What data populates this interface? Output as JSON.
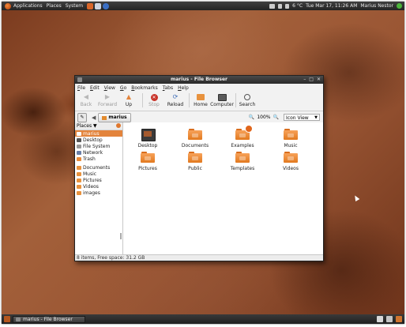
{
  "top_panel": {
    "menus": [
      "Applications",
      "Places",
      "System"
    ],
    "weather": "6 °C",
    "clock": "Tue Mar 17, 11:26 AM",
    "user": "Marius Nestor"
  },
  "window": {
    "title": "marius - File Browser",
    "menu": [
      "File",
      "Edit",
      "View",
      "Go",
      "Bookmarks",
      "Tabs",
      "Help"
    ],
    "toolbar": [
      {
        "label": "Back",
        "icon": "back-arrow-icon",
        "enabled": false
      },
      {
        "label": "Forward",
        "icon": "forward-arrow-icon",
        "enabled": false
      },
      {
        "label": "Up",
        "icon": "up-arrow-icon",
        "enabled": true
      },
      {
        "label": "Stop",
        "icon": "stop-icon",
        "enabled": false
      },
      {
        "label": "Reload",
        "icon": "reload-icon",
        "enabled": true
      },
      {
        "label": "Home",
        "icon": "home-icon",
        "enabled": true
      },
      {
        "label": "Computer",
        "icon": "computer-icon",
        "enabled": true
      },
      {
        "label": "Search",
        "icon": "search-icon",
        "enabled": true
      }
    ],
    "location": {
      "crumb": "marius",
      "zoom": "100%",
      "view_mode": "Icon View"
    },
    "sidebar": {
      "header": "Places ▼",
      "items": [
        {
          "label": "marius",
          "selected": true,
          "icon": "home-folder-icon"
        },
        {
          "label": "Desktop",
          "selected": false,
          "icon": "desktop-icon"
        },
        {
          "label": "File System",
          "selected": false,
          "icon": "drive-icon"
        },
        {
          "label": "Network",
          "selected": false,
          "icon": "network-icon"
        },
        {
          "label": "Trash",
          "selected": false,
          "icon": "trash-icon"
        },
        {
          "label": "Documents",
          "selected": false,
          "icon": "folder-icon"
        },
        {
          "label": "Music",
          "selected": false,
          "icon": "folder-icon"
        },
        {
          "label": "Pictures",
          "selected": false,
          "icon": "folder-icon"
        },
        {
          "label": "Videos",
          "selected": false,
          "icon": "folder-icon"
        },
        {
          "label": "images",
          "selected": false,
          "icon": "folder-icon"
        }
      ]
    },
    "files": [
      {
        "label": "Desktop",
        "icon": "desktop-folder-icon"
      },
      {
        "label": "Documents",
        "icon": "folder-icon"
      },
      {
        "label": "Examples",
        "icon": "folder-icon"
      },
      {
        "label": "Music",
        "icon": "folder-icon"
      },
      {
        "label": "Pictures",
        "icon": "folder-icon"
      },
      {
        "label": "Public",
        "icon": "folder-icon"
      },
      {
        "label": "Templates",
        "icon": "folder-icon"
      },
      {
        "label": "Videos",
        "icon": "folder-icon"
      }
    ],
    "status": "8 items, Free space: 31.2 GB"
  },
  "taskbar": {
    "task_label": "marius - File Browser"
  },
  "colors": {
    "accent": "#e3843c",
    "panel": "#2b2b2b"
  }
}
